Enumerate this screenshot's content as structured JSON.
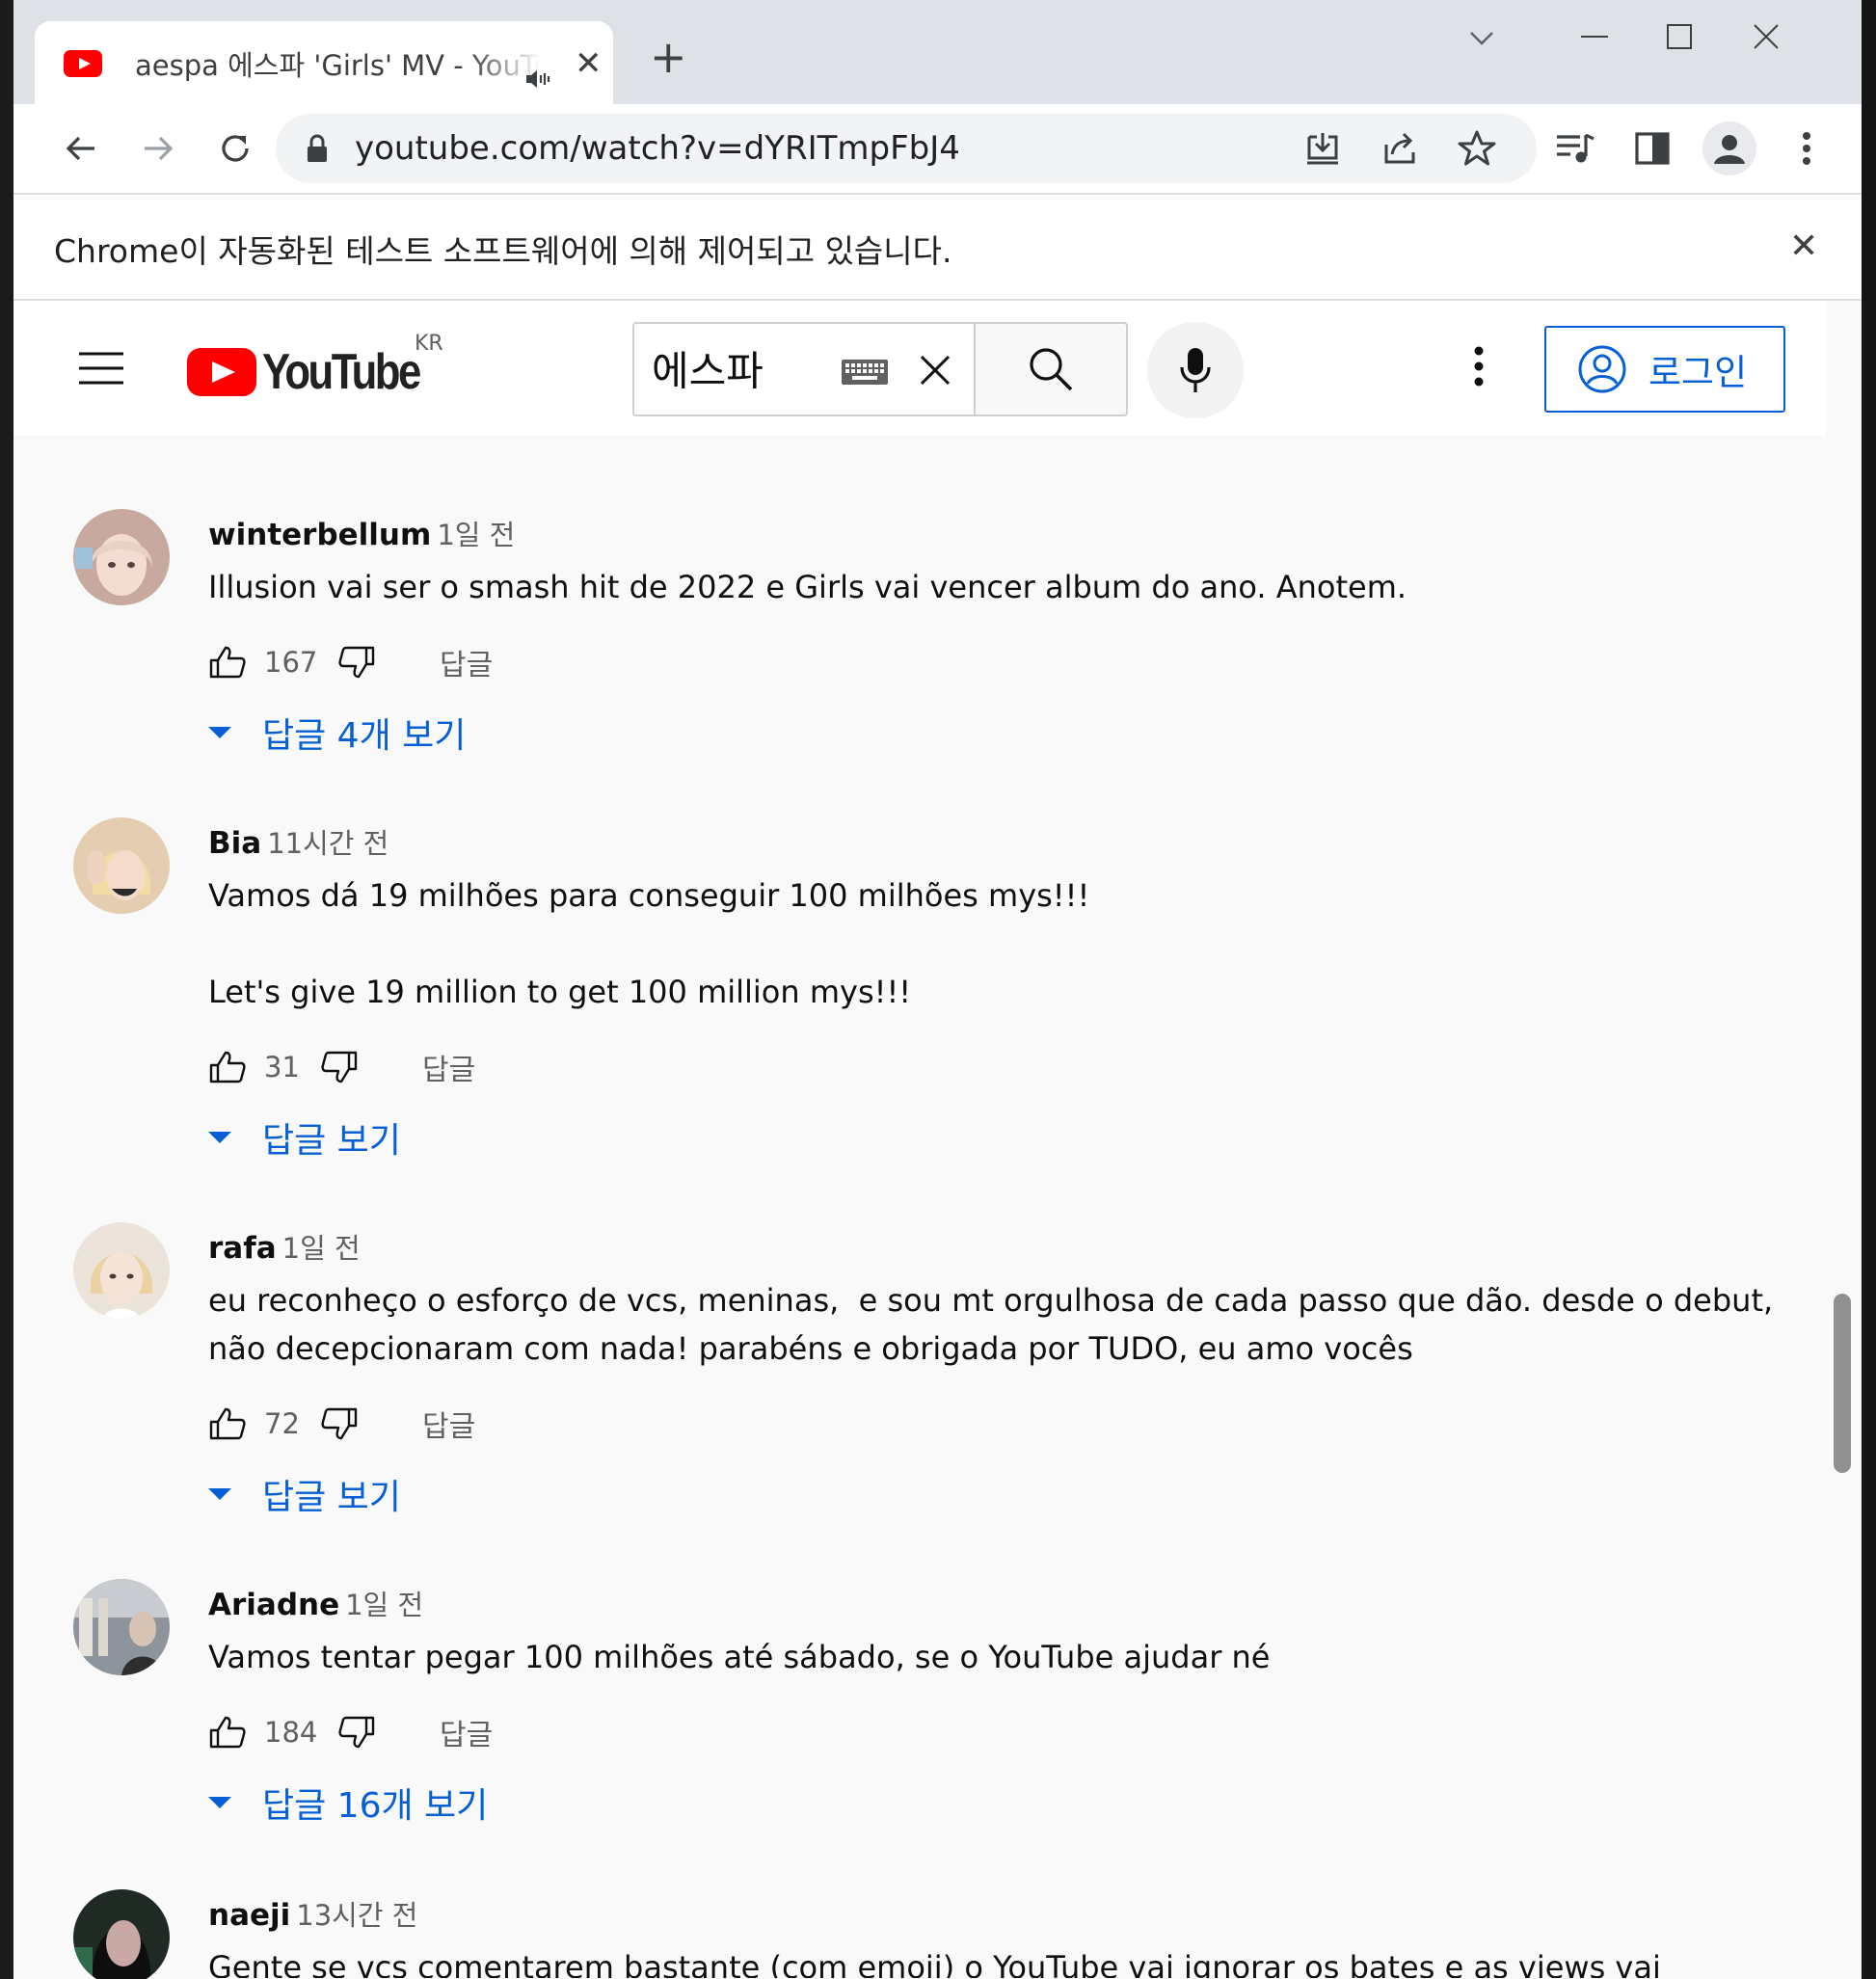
{
  "browser": {
    "tab": {
      "title": "aespa 에스파 'Girls' MV - YouTube"
    },
    "address": {
      "url": "youtube.com/watch?v=dYRITmpFbJ4"
    },
    "infobar": {
      "text": "Chrome이 자동화된 테스트 소프트웨어에 의해 제어되고 있습니다."
    }
  },
  "youtube": {
    "logo_text": "YouTube",
    "country": "KR",
    "search": {
      "value": "에스파"
    },
    "signin_label": "로그인"
  },
  "comments": [
    {
      "author": "winterbellum",
      "time": "1일 전",
      "text": [
        "Illusion vai ser o smash hit de 2022 e Girls vai vencer album do ano. Anotem."
      ],
      "likes": "167",
      "reply": "답글",
      "view_replies": "답글 4개 보기",
      "avatar_color": "#d8b8b0"
    },
    {
      "author": "Bia",
      "time": "11시간 전",
      "text": [
        "Vamos dá 19 milhões para conseguir 100 milhões mys!!!",
        "",
        "Let's give 19 million to get 100 million mys!!!"
      ],
      "likes": "31",
      "reply": "답글",
      "view_replies": "답글 보기",
      "avatar_color": "#e8d0b4"
    },
    {
      "author": "rafa",
      "time": "1일 전",
      "text": [
        "eu reconheço o esforço de vcs, meninas,  e sou mt orgulhosa de cada passo que dão. desde o debut,",
        "não decepcionaram com nada! parabéns e obrigada por TUDO, eu amo vocês"
      ],
      "likes": "72",
      "reply": "답글",
      "view_replies": "답글 보기",
      "avatar_color": "#f0e0c8"
    },
    {
      "author": "Ariadne",
      "time": "1일 전",
      "text": [
        "Vamos tentar pegar 100 milhões até sábado, se o YouTube ajudar né"
      ],
      "likes": "184",
      "reply": "답글",
      "view_replies": "답글 16개 보기",
      "avatar_color": "#9aa0a8"
    },
    {
      "author": "naeji",
      "time": "13시간 전",
      "text": [
        "Gente se vcs comentarem bastante (com emoji) o YouTube vai ignorar os bates e as views vai"
      ],
      "likes": "",
      "reply": "",
      "view_replies": "",
      "avatar_color": "#2a3a30"
    }
  ]
}
